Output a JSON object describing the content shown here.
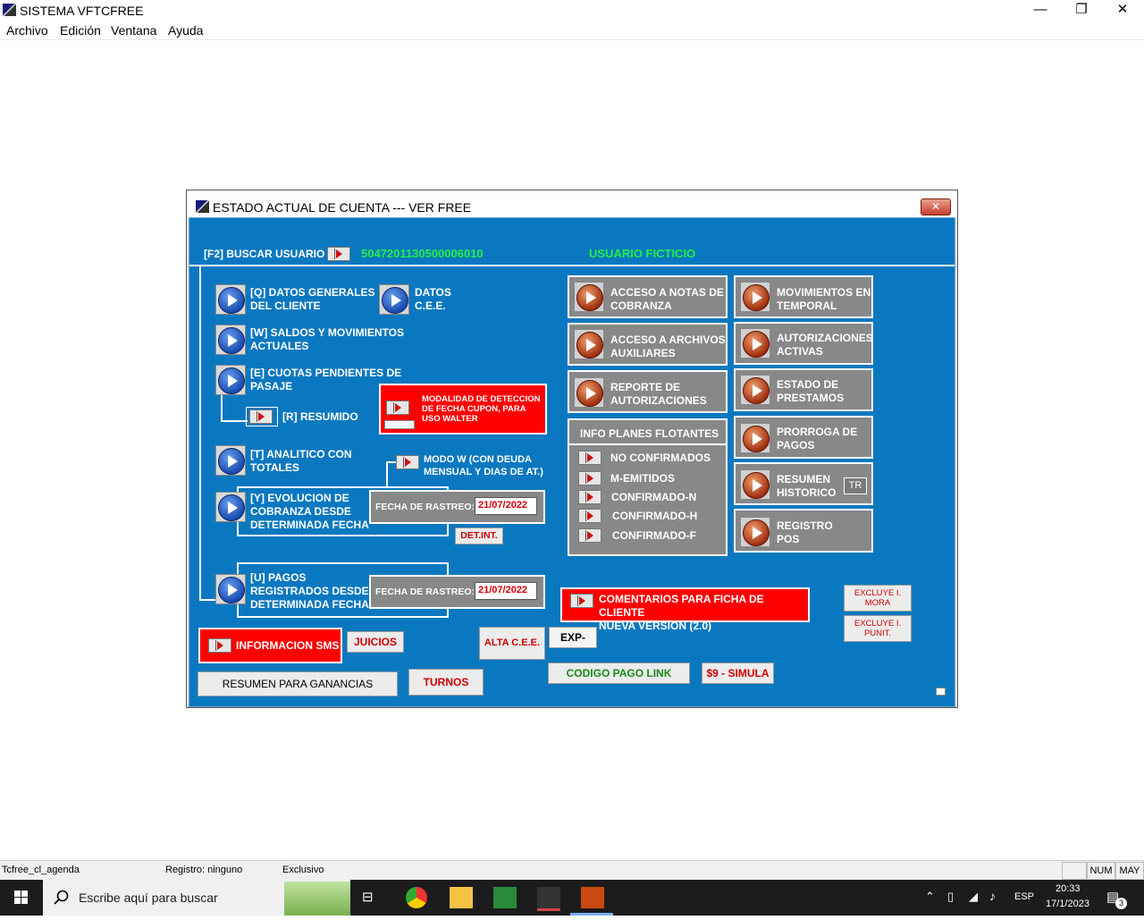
{
  "app": {
    "title": "SISTEMA VFTCFREE",
    "minimize": "—",
    "maximize": "❐",
    "close": "✕"
  },
  "menu": [
    "Archivo",
    "Edición",
    "Ventana",
    "Ayuda"
  ],
  "dialog": {
    "title": "ESTADO ACTUAL DE CUENTA  ---  VER FREE",
    "close": "✕",
    "search_label": "[F2] BUSCAR USUARIO",
    "user_number": "5047201130500006010",
    "user_name": "USUARIO FICTICIO",
    "left": {
      "datos_generales": [
        "[Q] DATOS GENERALES",
        "DEL CLIENTE"
      ],
      "datos_cee": [
        "DATOS",
        "C.E.E."
      ],
      "saldos": [
        "[W] SALDOS Y MOVIMIENTOS",
        "ACTUALES"
      ],
      "cuotas": [
        "[E] CUOTAS PENDIENTES DE",
        "PASAJE"
      ],
      "resumido": "[R] RESUMIDO",
      "analitico": [
        "[T] ANALITICO CON",
        "TOTALES"
      ],
      "modo_w": [
        "MODO W (CON DEUDA",
        "MENSUAL Y DIAS DE AT.)"
      ],
      "evolucion": [
        "[Y] EVOLUCION DE",
        "COBRANZA DESDE",
        "DETERMINADA FECHA"
      ],
      "fecha_label_1": "FECHA DE RASTREO:",
      "fecha_value_1": "21/07/2022",
      "det_int": "DET.INT.",
      "pagos": [
        "[U] PAGOS",
        "REGISTRADOS DESDE",
        "DETERMINADA FECHA"
      ],
      "fecha_label_2": "FECHA DE RASTREO:",
      "fecha_value_2": "21/07/2022"
    },
    "modalidad": [
      "MODALIDAD DE DETECCION",
      "DE FECHA CUPON, PARA",
      "USO WALTER"
    ],
    "middle": {
      "notas": [
        "ACCESO A NOTAS DE",
        "COBRANZA"
      ],
      "archivos": [
        "ACCESO A ARCHIVOS",
        "AUXILIARES"
      ],
      "reporte": [
        "REPORTE DE",
        "AUTORIZACIONES"
      ],
      "info_title": "INFO PLANES FLOTANTES",
      "info_items": [
        "NO CONFIRMADOS",
        "M-EMITIDOS",
        "CONFIRMADO-N",
        "CONFIRMADO-H",
        "CONFIRMADO-F"
      ]
    },
    "right": {
      "movimientos": [
        "MOVIMIENTOS EN",
        "TEMPORAL"
      ],
      "autorizaciones": [
        "AUTORIZACIONES",
        "ACTIVAS"
      ],
      "estado": [
        "ESTADO DE",
        "PRESTAMOS"
      ],
      "prorroga": [
        "PRORROGA DE",
        "PAGOS"
      ],
      "resumen": [
        "RESUMEN",
        "HISTORICO"
      ],
      "tr": "TR",
      "registro": [
        "REGISTRO",
        "POS"
      ]
    },
    "comentarios": [
      "COMENTARIOS PARA FICHA DE CLIENTE",
      "NUEVA VERSION (2.0)"
    ],
    "excluye_mora": [
      "EXCLUYE I.",
      "MORA"
    ],
    "excluye_punit": [
      "EXCLUYE I.",
      "PUNIT."
    ],
    "info_sms": "INFORMACION SMS",
    "juicios": "JUICIOS",
    "alta_cee": "ALTA C.E.E.",
    "exp_vyc": "EXP-VYC",
    "codigo_pago": "CODIGO PAGO LINK",
    "simula": "$9 - SIMULA",
    "resumen_ganancias": "RESUMEN PARA GANANCIAS",
    "turnos": "TURNOS"
  },
  "statusbar": {
    "form": "Tcfree_cl_agenda",
    "registro": "Registro: ninguno",
    "modo": "Exclusivo",
    "num": "NUM",
    "may": "MAY"
  },
  "taskbar": {
    "search_placeholder": "Escribe aquí para buscar",
    "lang": "ESP",
    "time": "20:33",
    "date": "17/1/2023",
    "notifications": "3"
  },
  "colors": {
    "panel_blue": "#0a78c0",
    "accent_red": "#ff0000",
    "panel_grey": "#888888",
    "green_text": "#22ee44"
  }
}
